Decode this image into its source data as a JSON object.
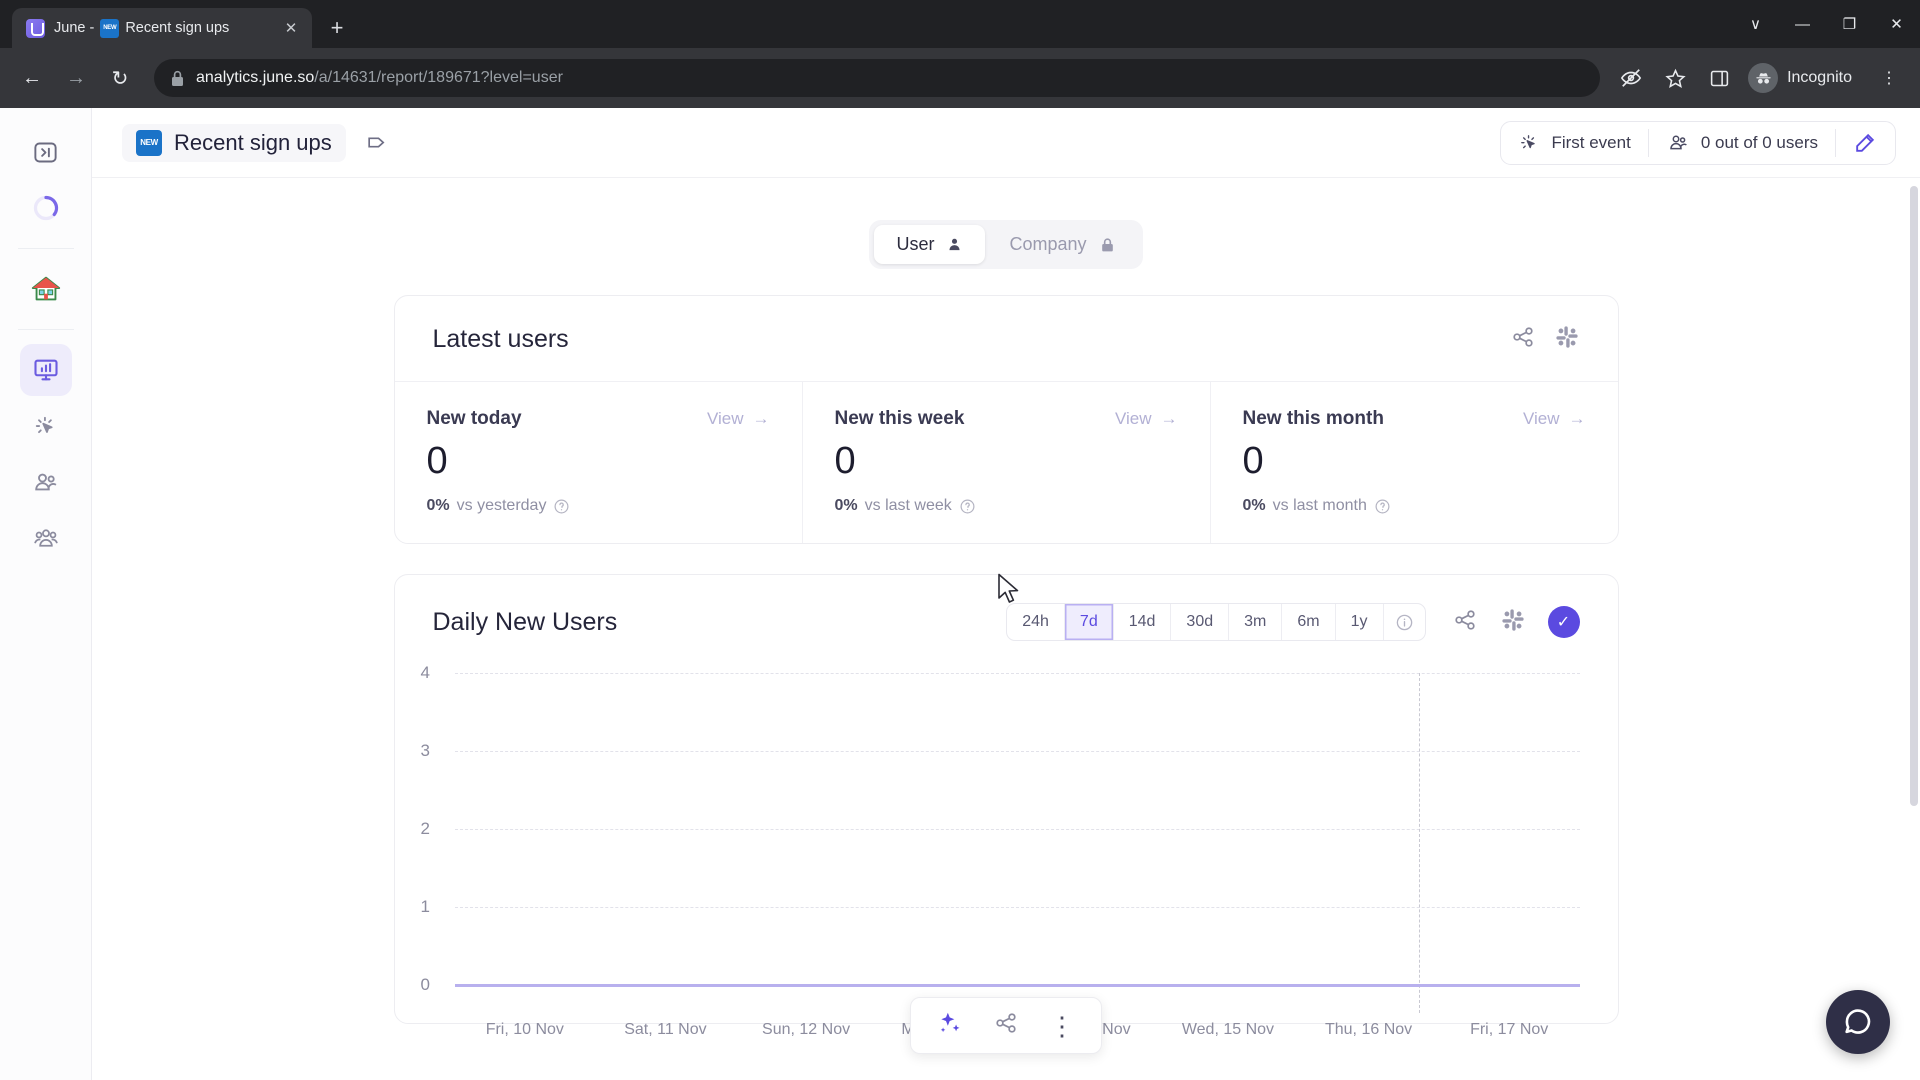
{
  "browser": {
    "tab": {
      "title": "June -",
      "doc_title": "Recent sign ups",
      "favicon": "june-logo-icon",
      "close": "✕"
    },
    "new_tab_label": "+",
    "window_controls": {
      "minimize": "—",
      "maximize": "❐",
      "close": "✕",
      "tab_search": "∨"
    },
    "nav": {
      "back": "←",
      "forward": "→",
      "reload": "↻"
    },
    "url": {
      "lock": "lock-icon",
      "host": "analytics.june.so",
      "path": "/a/14631/report/189671?level=user"
    },
    "omni_icons": [
      "tracking-protection-icon",
      "bookmark-star-icon",
      "side-panel-icon"
    ],
    "profile": {
      "label": "Incognito",
      "icon": "incognito-avatar"
    },
    "menu": "⋮"
  },
  "sidebar": {
    "items": [
      {
        "name": "expand-panel",
        "icon": "panel-expand-icon"
      },
      {
        "name": "loading-progress",
        "icon": "progress-ring-icon"
      },
      {
        "name": "home",
        "icon": "house-icon"
      },
      {
        "name": "reports",
        "icon": "presentation-chart-icon",
        "active": true
      },
      {
        "name": "events",
        "icon": "click-cursor-icon"
      },
      {
        "name": "users",
        "icon": "users-icon"
      },
      {
        "name": "companies",
        "icon": "companies-group-icon"
      }
    ]
  },
  "header": {
    "report_icon": "new-badge-icon",
    "report_title": "Recent sign ups",
    "tag_button": "tag-icon",
    "first_event": {
      "icon": "click-cursor-icon",
      "label": "First event"
    },
    "audience": {
      "icon": "users-icon",
      "label": "0 out of 0 users"
    },
    "edit_button": "edit-pencil-icon"
  },
  "level_toggle": {
    "options": [
      {
        "label": "User",
        "icon": "person-icon",
        "active": true,
        "locked": false
      },
      {
        "label": "Company",
        "icon": "lock-icon",
        "active": false,
        "locked": true
      }
    ]
  },
  "latest_users_card": {
    "title": "Latest users",
    "actions": [
      {
        "name": "share-button",
        "icon": "share-icon"
      },
      {
        "name": "slack-button",
        "icon": "slack-icon"
      }
    ],
    "stats": [
      {
        "label": "New today",
        "view": "View",
        "arrow": "→",
        "value": "0",
        "pct": "0%",
        "comparison": "vs yesterday",
        "info": "info-icon"
      },
      {
        "label": "New this week",
        "view": "View",
        "arrow": "→",
        "value": "0",
        "pct": "0%",
        "comparison": "vs last week",
        "info": "info-icon"
      },
      {
        "label": "New this month",
        "view": "View",
        "arrow": "→",
        "value": "0",
        "pct": "0%",
        "comparison": "vs last month",
        "info": "info-icon"
      }
    ]
  },
  "daily_new_users_card": {
    "title": "Daily New Users",
    "ranges": [
      {
        "label": "24h",
        "active": false
      },
      {
        "label": "7d",
        "active": true
      },
      {
        "label": "14d",
        "active": false
      },
      {
        "label": "30d",
        "active": false
      },
      {
        "label": "3m",
        "active": false
      },
      {
        "label": "6m",
        "active": false
      },
      {
        "label": "1y",
        "active": false
      }
    ],
    "range_info_icon": "info-icon",
    "actions": [
      {
        "name": "share-button",
        "icon": "share-icon"
      },
      {
        "name": "slack-button",
        "icon": "slack-icon"
      },
      {
        "name": "saved-indicator",
        "icon": "check-icon",
        "glyph": "✓"
      }
    ]
  },
  "chart_data": {
    "type": "line",
    "title": "Daily New Users",
    "xlabel": "",
    "ylabel": "",
    "x": [
      "Fri, 10 Nov",
      "Sat, 11 Nov",
      "Sun, 12 Nov",
      "Mon, 13 Nov",
      "Tue, 14 Nov",
      "Wed, 15 Nov",
      "Thu, 16 Nov",
      "Fri, 17 Nov"
    ],
    "values": [
      0,
      0,
      0,
      0,
      0,
      0,
      0,
      0
    ],
    "yticks": [
      "4",
      "3",
      "2",
      "1",
      "0"
    ],
    "ylim": [
      0,
      4
    ],
    "grid": true,
    "legend": false,
    "series_color": "#8b7ee8",
    "marker_line_index": 6,
    "marker_line_style": "dashed"
  },
  "float_toolbar": {
    "items": [
      {
        "name": "ai-insights-button",
        "icon": "sparkles-icon"
      },
      {
        "name": "share-button",
        "icon": "share-icon"
      },
      {
        "name": "more-options-button",
        "icon": "more-vertical-icon",
        "glyph": "⋮"
      }
    ]
  },
  "chat_widget": {
    "icon": "chat-bubble-icon"
  },
  "colors": {
    "accent": "#5b4ae0",
    "accent_soft": "#efedfd",
    "chart_line": "#b8b0ee",
    "text": "#25253a",
    "muted": "#8c8c9e"
  }
}
